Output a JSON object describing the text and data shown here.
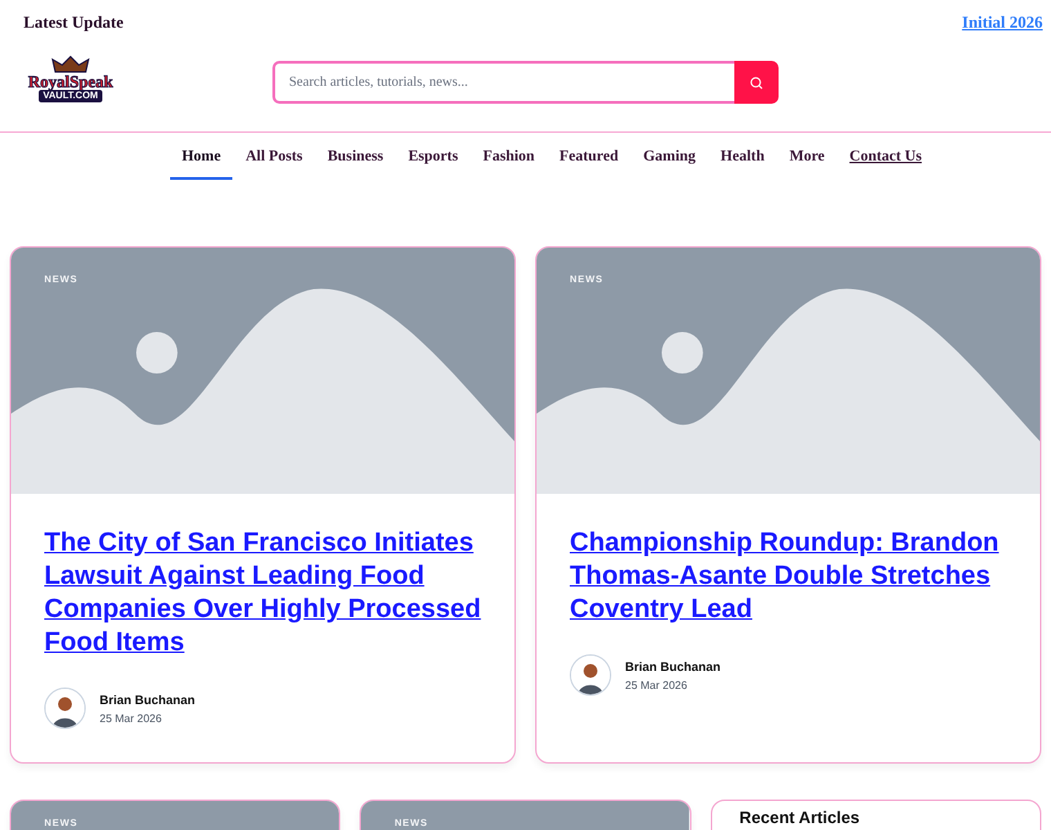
{
  "top_bar": {
    "label": "Latest Update",
    "link": "Initial 2026"
  },
  "logo": {
    "name": "RoyalSpeak",
    "domain": "VAULT.COM"
  },
  "search": {
    "placeholder": "Search articles, tutorials, news..."
  },
  "nav": [
    {
      "label": "Home",
      "selected": true,
      "kind": "item"
    },
    {
      "label": "All Posts",
      "selected": false,
      "kind": "item"
    },
    {
      "label": "Business",
      "selected": false,
      "kind": "item"
    },
    {
      "label": "Esports",
      "selected": false,
      "kind": "item"
    },
    {
      "label": "Fashion",
      "selected": false,
      "kind": "item"
    },
    {
      "label": "Featured",
      "selected": false,
      "kind": "item"
    },
    {
      "label": "Gaming",
      "selected": false,
      "kind": "item"
    },
    {
      "label": "Health",
      "selected": false,
      "kind": "item"
    },
    {
      "label": "More",
      "selected": false,
      "kind": "item"
    },
    {
      "label": "Contact Us",
      "selected": false,
      "kind": "link"
    }
  ],
  "featured": [
    {
      "category": "NEWS",
      "title": "The City of San Francisco Initiates Lawsuit Against Leading Food Companies Over Highly Processed Food Items",
      "author": "Brian Buchanan",
      "date": "25 Mar 2026"
    },
    {
      "category": "NEWS",
      "title": "Championship Roundup: Brandon Thomas-Asante Double Stretches Coventry Lead",
      "author": "Brian Buchanan",
      "date": "25 Mar 2026"
    }
  ],
  "more_cards": [
    {
      "category": "NEWS"
    },
    {
      "category": "NEWS"
    }
  ],
  "sidebar": {
    "title": "Recent Articles"
  }
}
